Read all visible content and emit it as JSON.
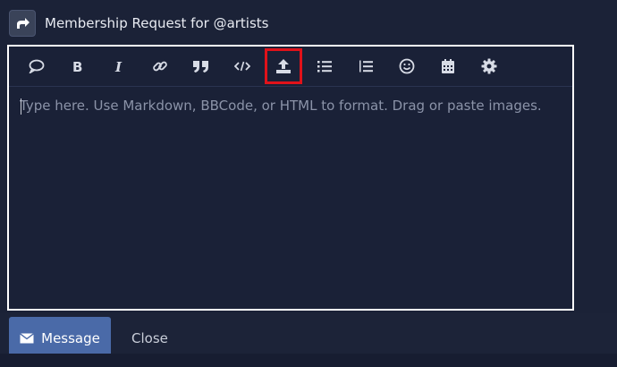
{
  "header": {
    "title": "Membership Request for @artists",
    "reply_icon": "share-arrow-icon"
  },
  "toolbar": {
    "buttons": [
      {
        "name": "speech-bubble-icon",
        "label": ""
      },
      {
        "name": "bold-icon",
        "label": "B"
      },
      {
        "name": "italic-icon",
        "label": "I"
      },
      {
        "name": "link-icon",
        "label": ""
      },
      {
        "name": "quote-icon",
        "label": ""
      },
      {
        "name": "code-icon",
        "label": ""
      },
      {
        "name": "upload-icon",
        "label": "",
        "highlighted": true
      },
      {
        "name": "bullet-list-icon",
        "label": ""
      },
      {
        "name": "numbered-list-icon",
        "label": ""
      },
      {
        "name": "emoji-icon",
        "label": ""
      },
      {
        "name": "calendar-icon",
        "label": ""
      },
      {
        "name": "gear-icon",
        "label": ""
      }
    ]
  },
  "editor": {
    "placeholder": "Type here. Use Markdown, BBCode, or HTML to format. Drag or paste images.",
    "value": ""
  },
  "footer": {
    "message_label": "Message",
    "close_label": "Close"
  },
  "colors": {
    "background": "#1b2237",
    "highlight": "#e0121a",
    "primary_button": "#4a6aa8"
  }
}
